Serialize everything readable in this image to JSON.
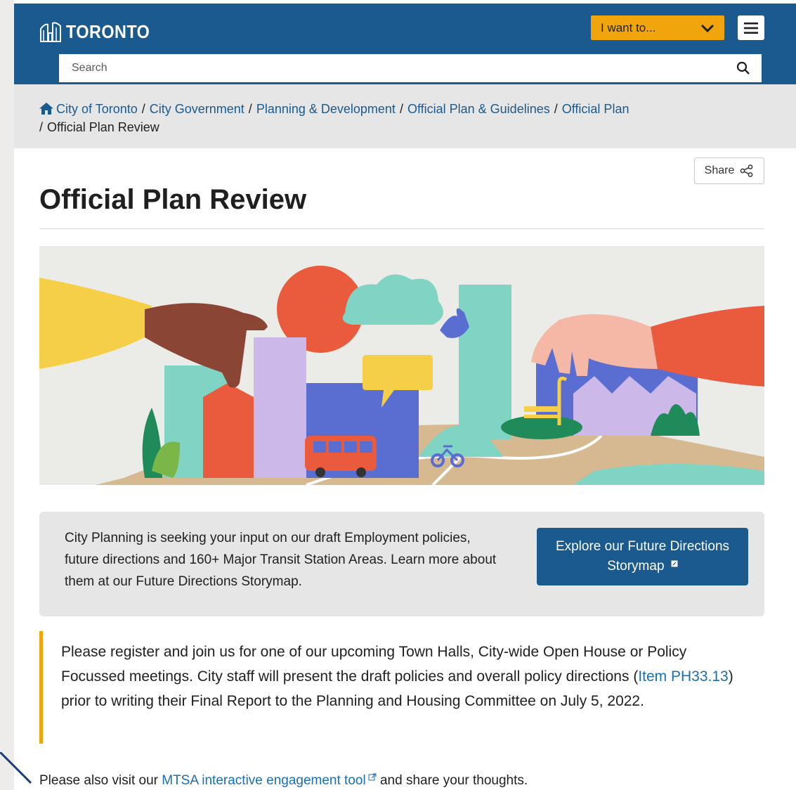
{
  "header": {
    "logo_text": "TORONTO",
    "i_want_label": "I want to...",
    "search_placeholder": "Search"
  },
  "breadcrumb": {
    "items": [
      "City of Toronto",
      "City Government",
      "Planning & Development",
      "Official Plan & Guidelines",
      "Official Plan"
    ],
    "current": "Official Plan Review",
    "separator": "/"
  },
  "share_label": "Share",
  "page_title": "Official Plan Review",
  "callout": {
    "text": "City Planning is seeking your input on our draft Employment policies, future directions and 160+ Major Transit Station Areas. Learn more about them at our Future Directions Storymap.",
    "button_label": "Explore our Future Directions Storymap"
  },
  "notice": {
    "text_before": "Please register and join us for one of our upcoming Town Halls, City-wide Open House or Policy Focussed meetings. City staff will present the draft policies and overall policy directions (",
    "link_text": "Item PH33.13",
    "text_after": ") prior to writing their Final Report to the Planning and Housing Committee on July 5, 2022."
  },
  "bottom": {
    "text_before": "Please also visit our ",
    "link_text": "MTSA interactive engagement tool",
    "text_after": " and share your thoughts."
  },
  "colors": {
    "header_blue": "#1a5a8e",
    "accent_orange": "#f0a50c",
    "link_blue": "#1a6fb0"
  }
}
